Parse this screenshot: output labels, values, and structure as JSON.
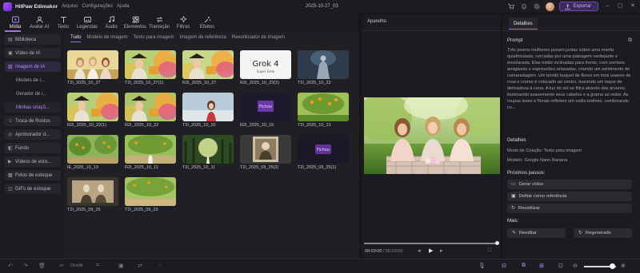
{
  "titlebar": {
    "app_name": "HitPaw Edimakor",
    "menus": [
      "Arquivo",
      "Configurações",
      "Ajuda"
    ],
    "document": "2025-10-27_03",
    "export_label": "Exportar"
  },
  "toolbar": {
    "tools": [
      {
        "label": "Mídia",
        "icon": "media-icon",
        "active": true
      },
      {
        "label": "Avatar AI",
        "icon": "avatar-icon"
      },
      {
        "label": "Texto",
        "icon": "text-icon"
      },
      {
        "label": "Legendas",
        "icon": "subtitles-icon"
      },
      {
        "label": "Áudio",
        "icon": "audio-icon"
      },
      {
        "label": "Elementos",
        "icon": "elements-icon"
      },
      {
        "label": "Transição",
        "icon": "transition-icon"
      },
      {
        "label": "Filtros",
        "icon": "filters-icon"
      },
      {
        "label": "Efeitos",
        "icon": "effects-icon"
      }
    ]
  },
  "sidebar": {
    "items": [
      {
        "label": "Biblioteca",
        "type": "item"
      },
      {
        "label": "Vídeo de IA",
        "type": "item"
      },
      {
        "label": "Imagem de IA",
        "type": "item",
        "selected": true
      },
      {
        "label": "Modelo de i...",
        "type": "sub"
      },
      {
        "label": "Gerador de i...",
        "type": "sub"
      },
      {
        "label": "Minhas criaçõ...",
        "type": "sub",
        "active": true
      },
      {
        "label": "Troca de Rostos",
        "type": "item"
      },
      {
        "label": "Aprimorador d...",
        "type": "item"
      },
      {
        "label": "Fundo",
        "type": "item"
      },
      {
        "label": "Vídeos de esto...",
        "type": "item"
      },
      {
        "label": "Fotos de estoque",
        "type": "item"
      },
      {
        "label": "GIFs de estoque",
        "type": "item"
      }
    ]
  },
  "media": {
    "tabs": [
      "Tudo",
      "Modelo de imagem",
      "Texto para imagem",
      "Imagem de referência",
      "Reestilizador de imagem"
    ],
    "items": [
      {
        "label": "T2I_2025_10_27",
        "style": "women-orange"
      },
      {
        "label": "T2I_2025_10_27(1)",
        "style": "pirate-flowers"
      },
      {
        "label": "R2I_2025_10_27",
        "style": "pirate-flowers2"
      },
      {
        "label": "R2I_2025_10_23(2)",
        "style": "grok"
      },
      {
        "label": "T2I_2025_10_22",
        "style": "armor"
      },
      {
        "label": "R2I_2025_10_22(1)",
        "style": "pirate-flowers"
      },
      {
        "label": "R2I_2025_10_22",
        "style": "pirate-field"
      },
      {
        "label": "T2I_2025_10_20",
        "style": "beach-girl"
      },
      {
        "label": "R2I_2025_10_16",
        "style": "fichou"
      },
      {
        "label": "T2I_2025_10_13",
        "style": "orange-tree"
      },
      {
        "label": "IE_2025_10_13",
        "style": "orchard"
      },
      {
        "label": "R2I_2025_10_11",
        "style": "orchard-kid"
      },
      {
        "label": "T2I_2025_10_11",
        "style": "forest-glow"
      },
      {
        "label": "T2I_2025_09_25(2)",
        "style": "vintage"
      },
      {
        "label": "T2I_2025_09_25(1)",
        "style": "fichou2"
      },
      {
        "label": "T2I_2025_09_25",
        "style": "vintage2"
      },
      {
        "label": "T2I_2025_09_23",
        "style": "orchard2"
      }
    ],
    "grok_text": "Grok 4",
    "grok_sub": "Super Grok",
    "fichou_text": "Fichou"
  },
  "preview": {
    "title": "Aparelho",
    "time_current": "00:03:00",
    "time_total": "00:03:00"
  },
  "details": {
    "tab": "Detalhes",
    "prompt_heading": "Prompt",
    "prompt": "Três jovens mulheres posam juntas sobre uma manta quadriculada, cercadas por uma paisagem verdejante e ensolarada. Elas estão inclinadas para frente, com sorrisos amigáveis e expressões relaxadas, criando um sentimento de camaradagem. Um bonito buquet de flores em tons suaves de rosa e creme é colocado ao centro, trazendo um toque de delicadeza à cena. A luz do sol se filtra através das árvores, iluminando suavemente seus cabelos e a grama ao redor. As roupas leves e florais refletem um estilo boêmio, combinando co...",
    "details_heading": "Detalhes",
    "mode": "Modo de Criação: Texto para imagem",
    "model": "Modelo: Google Nano Banana",
    "next_heading": "Próximos passos:",
    "next_actions": [
      "Gerar vídeo",
      "Definir como referência",
      "Reestilizar"
    ],
    "more_heading": "Mais:",
    "more_actions": [
      "Reeditar",
      "Regenerado"
    ]
  },
  "bottombar": {
    "divide_label": "Dividir"
  },
  "colors": {
    "accent": "#a66bff",
    "export_bg": "#3b2a5a"
  }
}
